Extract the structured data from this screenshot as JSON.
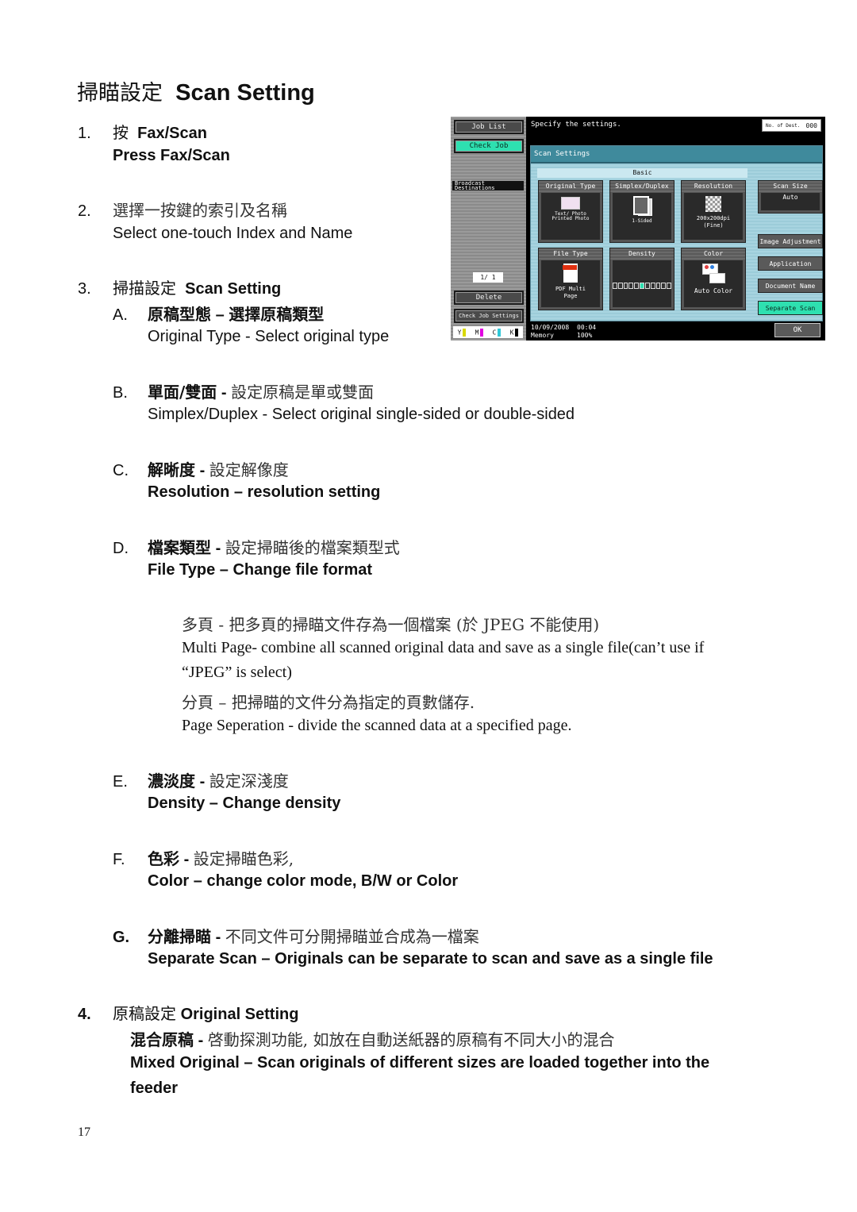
{
  "title": {
    "zh": "掃瞄設定",
    "en": "Scan Setting"
  },
  "steps": [
    {
      "num": "1.",
      "zh": "按",
      "en": "Fax/Scan",
      "sub": "Press Fax/Scan"
    },
    {
      "num": "2.",
      "zh": "選擇一按鍵的索引及名稱",
      "sub": "Select one-touch Index and Name"
    },
    {
      "num": "3.",
      "zh": "掃描設定",
      "en": "Scan Setting"
    },
    {
      "num": "4.",
      "zh": "原稿設定",
      "en": "Original Setting"
    }
  ],
  "sub_items": [
    {
      "letter": "A.",
      "zh_title": "原稿型態",
      "sep": "–",
      "zh_desc": "選擇原稿類型",
      "en": "Original Type - Select original type"
    },
    {
      "letter": "B.",
      "zh_title": "單面/雙面",
      "sep": "-",
      "zh_desc": "設定原稿是單或雙面",
      "en": "Simplex/Duplex - Select original single-sided or double-sided"
    },
    {
      "letter": "C.",
      "zh_title": "解晰度",
      "sep": "-",
      "zh_desc": "設定解像度",
      "en": "Resolution – resolution setting"
    },
    {
      "letter": "D.",
      "zh_title": "檔案類型",
      "sep": "-",
      "zh_desc": "設定掃瞄後的檔案類型式",
      "en": "File Type – Change file format"
    },
    {
      "letter": "E.",
      "zh_title": "濃淡度",
      "sep": "-",
      "zh_desc": "設定深淺度",
      "en": "Density – Change density"
    },
    {
      "letter": "F.",
      "zh_title": "色彩",
      "sep": "-",
      "zh_desc": "設定掃瞄色彩,",
      "en": "Color – change color mode, B/W or Color"
    },
    {
      "letter": "G.",
      "zh_title": "分離掃瞄",
      "sep": "-",
      "zh_desc": "不同文件可分開掃瞄並合成為一檔案",
      "en": "Separate Scan – Originals can be separate to scan and save as a single file"
    }
  ],
  "file_type_notes": {
    "multi_zh": "多頁 -   把多頁的掃瞄文件存為一個檔案 (於 JPEG 不能使用)",
    "multi_en_1": "Multi Page- combine all scanned original data and save as a single file(can’t use if",
    "multi_en_2": "“JPEG”   is select)",
    "sep_zh": "分頁   – 把掃瞄的文件分為指定的頁數儲存.",
    "sep_en": "Page Seperation - divide the scanned data at a specified page."
  },
  "original_setting": {
    "zh_title": "混合原稿",
    "sep": "-",
    "zh_desc": "啓動探測功能, 如放在自動送紙器的原稿有不同大小的混合",
    "en_1": "Mixed Original – Scan originals of different sizes are loaded together into the",
    "en_2": "feeder"
  },
  "page_number": "17",
  "screen": {
    "left_panel": {
      "job_list": "Job List",
      "check_job": "Check Job",
      "broadcast": "Broadcast Destinations",
      "page_counter": "1/  1",
      "delete": "Delete",
      "check_job_settings": "Check Job Settings",
      "toner": [
        "Y",
        "M",
        "C",
        "K"
      ]
    },
    "message": "Specify the settings.",
    "dest_label": "No. of Dest.",
    "dest_count": "000",
    "panel_title": "Scan Settings",
    "basic_label": "Basic",
    "tiles": [
      {
        "label": "Original Type",
        "value": "Text/ Photo Printed Photo"
      },
      {
        "label": "Simplex/Duplex",
        "value": "1-Sided"
      },
      {
        "label": "Resolution",
        "value": "200x200dpi (Fine)"
      },
      {
        "label": "File Type",
        "value": "PDF Multi Page"
      },
      {
        "label": "Density",
        "value": ""
      },
      {
        "label": "Color",
        "value": "Auto Color"
      }
    ],
    "density_level": 0.5,
    "scan_size": {
      "label": "Scan Size",
      "value": "Auto"
    },
    "side_buttons": [
      "Image Adjustment",
      "Application",
      "Document Name",
      "Separate Scan"
    ],
    "ok": "OK",
    "date": "10/09/2008",
    "time": "00:04",
    "memory_label": "Memory",
    "memory_value": "100%",
    "colors": {
      "accent_green": "#2ee0b0",
      "panel_blue": "#a8d4e0",
      "title_teal": "#3f8a9c"
    }
  }
}
